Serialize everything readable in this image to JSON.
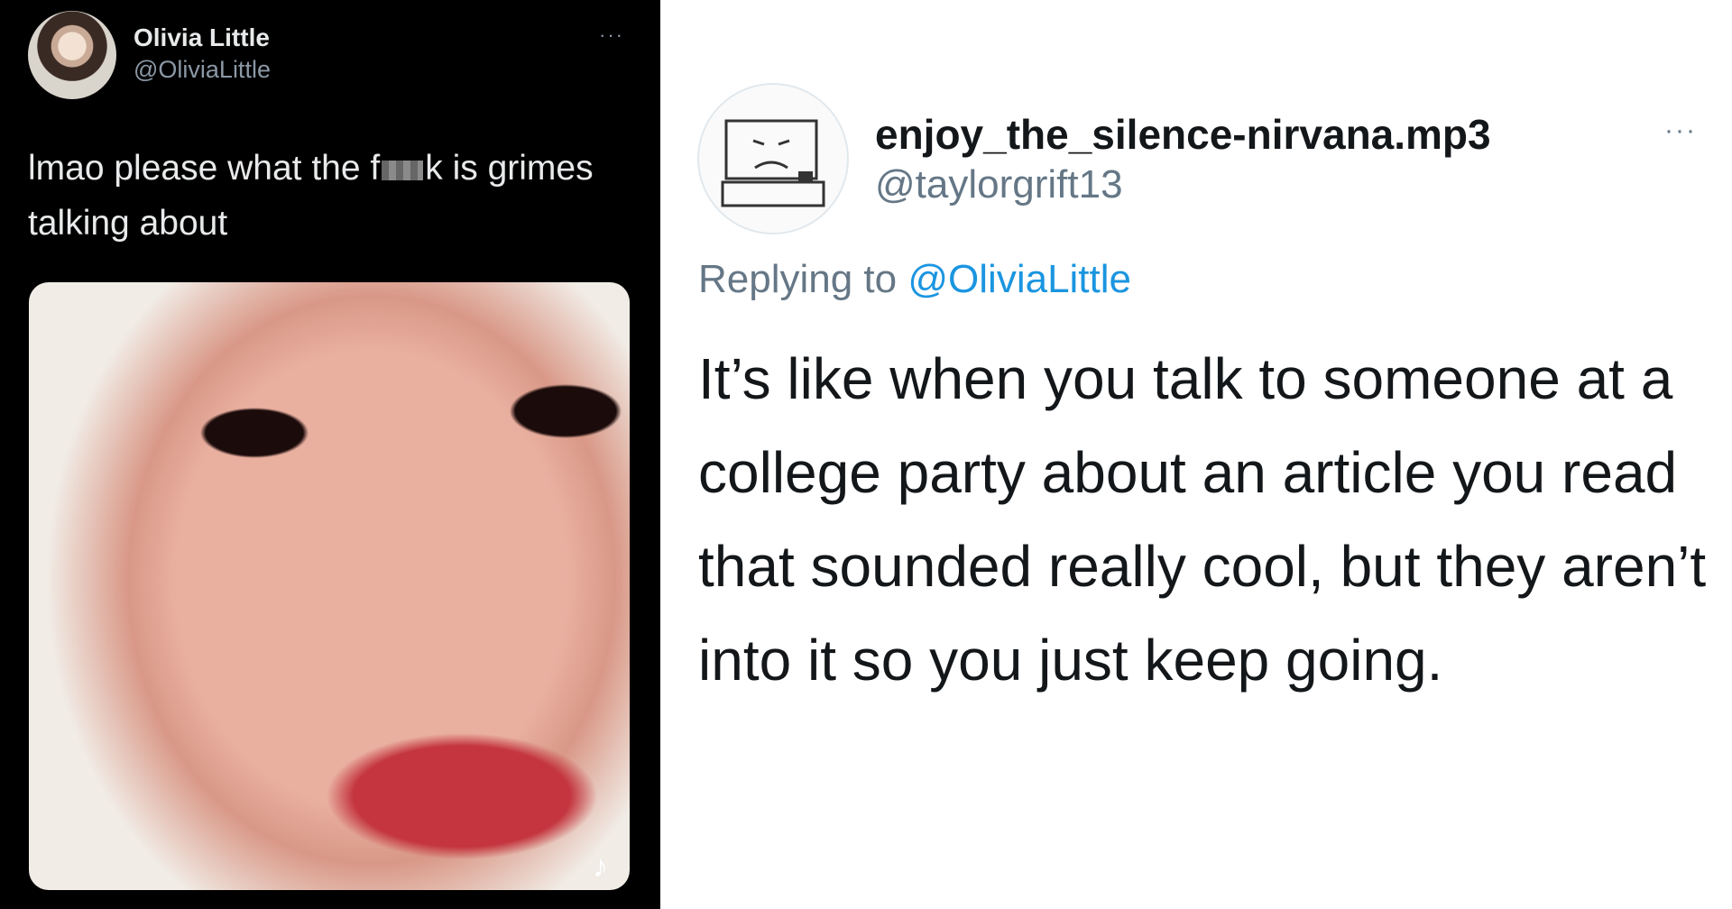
{
  "left_tweet": {
    "author_name": "Olivia Little",
    "author_handle": "@OliviaLittle",
    "more_label": "···",
    "text_part1": "lmao please what the f",
    "text_part2": "k is grimes talking about",
    "media_badge": "♪"
  },
  "right_tweet": {
    "author_name": "enjoy_the_silence-nirvana.mp3",
    "author_handle": "@taylorgrift13",
    "more_label": "···",
    "replying_prefix": "Replying to",
    "replying_mention": "@OliviaLittle",
    "text": "It’s like when you talk to someone at a college party about an article you read that sounded really cool, but they aren’t into it so you just keep going."
  },
  "colors": {
    "left_background": "#000000",
    "right_background": "#ffffff",
    "mention_blue": "#1b95e0",
    "secondary_gray": "#657786"
  }
}
